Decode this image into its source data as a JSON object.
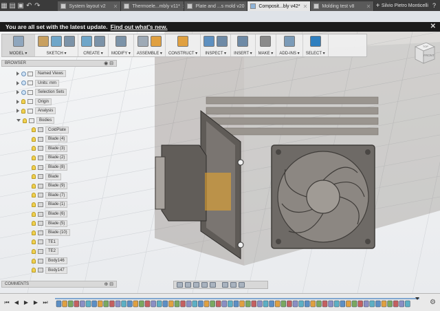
{
  "tabs": [
    {
      "label": "System layout v2",
      "active": false
    },
    {
      "label": "Thermoele...mbly v11*",
      "active": false
    },
    {
      "label": "Plate and ...s mold v20",
      "active": false
    },
    {
      "label": "Composit...bly v42*",
      "active": true
    },
    {
      "label": "Molding test v8",
      "active": false
    }
  ],
  "user_name": "Silvio Pietro Monticelli",
  "banner": {
    "message": "You are all set with the latest update.",
    "link": "Find out what's new."
  },
  "toolbar": {
    "groups": [
      {
        "label": "MODEL ▾",
        "icons": 1
      },
      {
        "label": "SKETCH ▾",
        "icons": 3
      },
      {
        "label": "CREATE ▾",
        "icons": 2
      },
      {
        "label": "MODIFY ▾",
        "icons": 1
      },
      {
        "label": "ASSEMBLE ▾",
        "icons": 2
      },
      {
        "label": "CONSTRUCT ▾",
        "icons": 1
      },
      {
        "label": "INSPECT ▾",
        "icons": 2
      },
      {
        "label": "INSERT ▾",
        "icons": 1
      },
      {
        "label": "MAKE ▾",
        "icons": 1
      },
      {
        "label": "ADD-INS ▾",
        "icons": 1
      },
      {
        "label": "SELECT ▾",
        "icons": 1
      }
    ]
  },
  "viewcube": {
    "front": "FRONT",
    "top": "TOP"
  },
  "browser": {
    "title": "BROWSER",
    "items": [
      {
        "label": "Named Views",
        "kind": "folder"
      },
      {
        "label": "Units: mm",
        "kind": "doc"
      },
      {
        "label": "Selection Sets",
        "kind": "folder"
      },
      {
        "label": "Origin",
        "kind": "folder"
      },
      {
        "label": "Analysis",
        "kind": "folder"
      },
      {
        "label": "Bodies",
        "kind": "folder"
      }
    ],
    "bodies": [
      "ColdPlate",
      "Blade (4)",
      "Blade (3)",
      "Blade (2)",
      "Blade (8)",
      "Blade",
      "Blade (9)",
      "Blade (7)",
      "Blade (1)",
      "Blade (6)",
      "Blade (5)",
      "Blade (10)",
      "TE1",
      "TE2",
      "Body146",
      "Body147"
    ]
  },
  "comments": {
    "title": "COMMENTS"
  },
  "timeline": {
    "features": 60
  }
}
